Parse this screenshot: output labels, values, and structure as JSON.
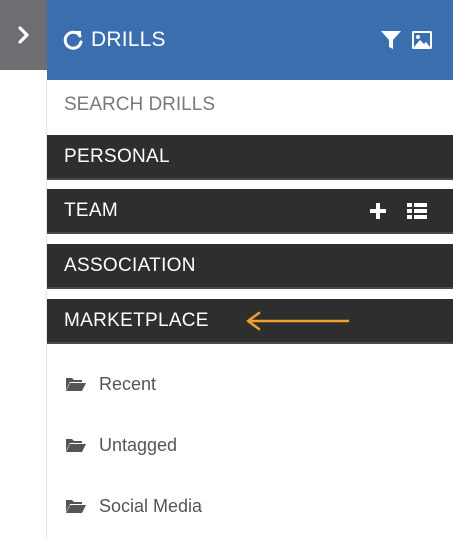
{
  "header": {
    "title": "DRILLS"
  },
  "search": {
    "placeholder": "SEARCH DRILLS"
  },
  "sections": {
    "personal": "PERSONAL",
    "team": "TEAM",
    "association": "ASSOCIATION",
    "marketplace": "MARKETPLACE"
  },
  "folders": {
    "recent": "Recent",
    "untagged": "Untagged",
    "social_media": "Social Media"
  },
  "colors": {
    "header_bg": "#3b6eaf",
    "section_bg": "#2e2e2e",
    "annotation_arrow": "#f0a030"
  }
}
